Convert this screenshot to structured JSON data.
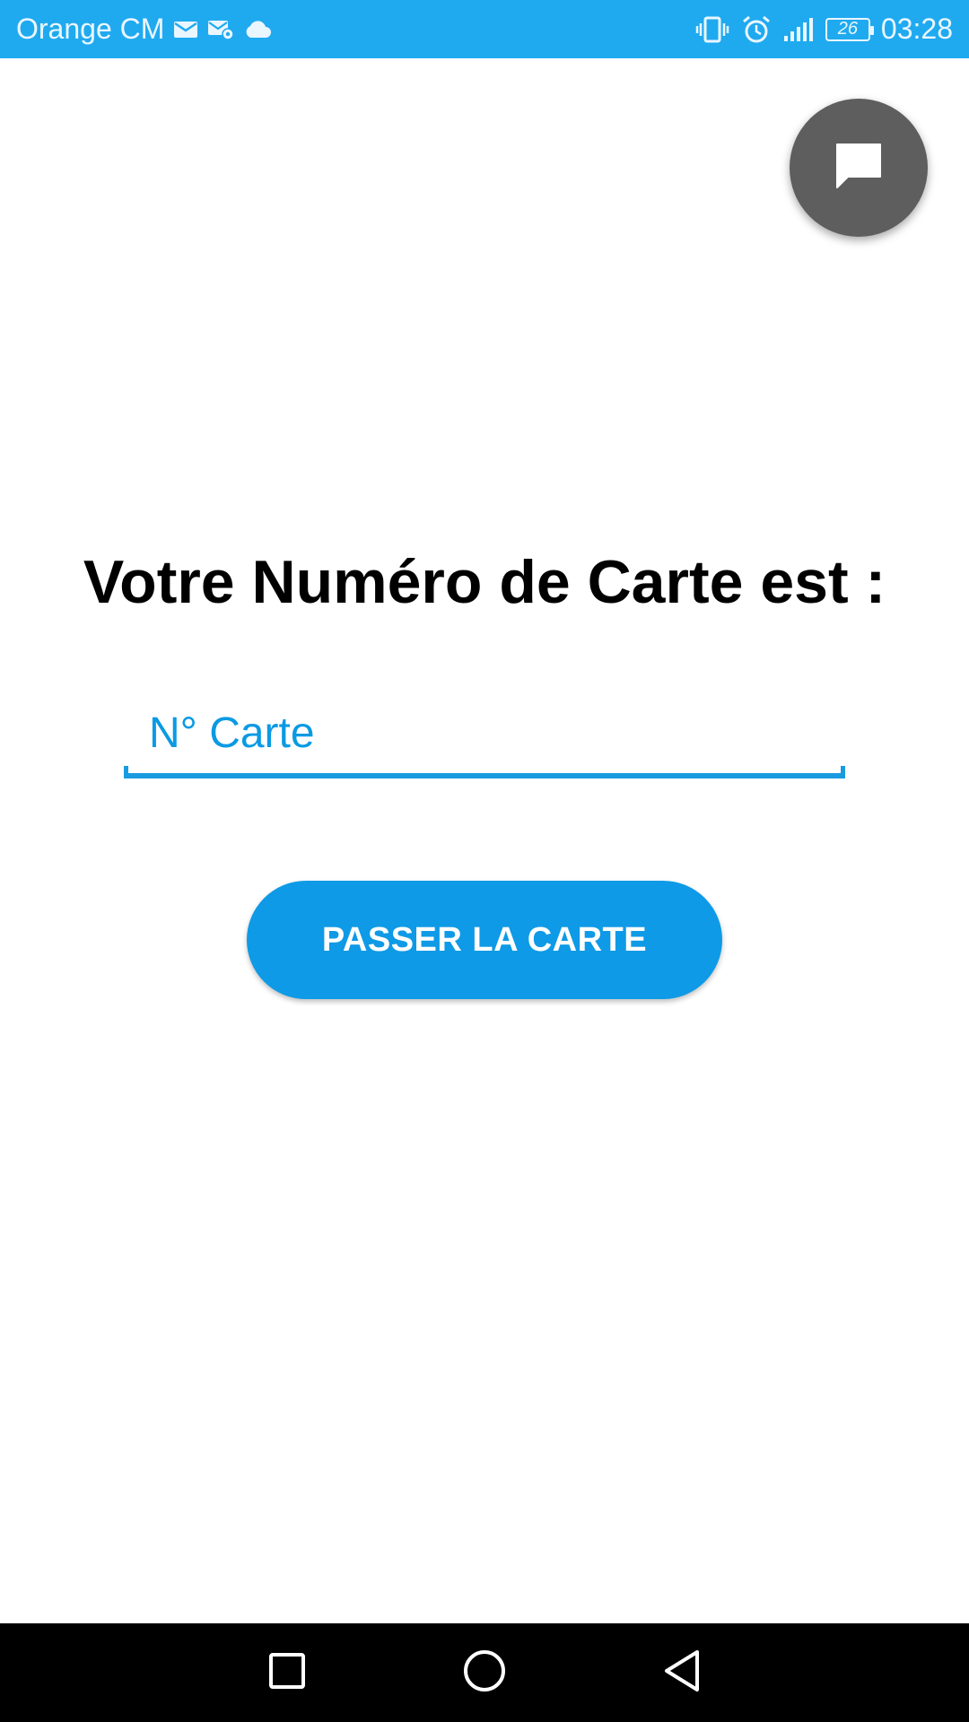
{
  "status_bar": {
    "carrier": "Orange CM",
    "battery_level": "26",
    "time": "03:28",
    "icons": [
      "mail-icon",
      "mail-settings-icon",
      "cloud-icon",
      "vibrate-icon",
      "alarm-icon",
      "signal-icon",
      "battery-icon"
    ]
  },
  "chat_fab": {
    "icon": "chat-icon"
  },
  "main": {
    "title": "Votre Numéro de Carte est :",
    "card_input": {
      "placeholder": "N° Carte",
      "value": ""
    },
    "pass_button_label": "PASSER LA CARTE"
  },
  "nav_bar": {
    "icons": [
      "recents-icon",
      "home-icon",
      "back-icon"
    ]
  },
  "colors": {
    "status_bar": "#1faaf0",
    "accent": "#0e9ae6",
    "fab": "#5e5e5e",
    "nav_bar": "#000000"
  }
}
